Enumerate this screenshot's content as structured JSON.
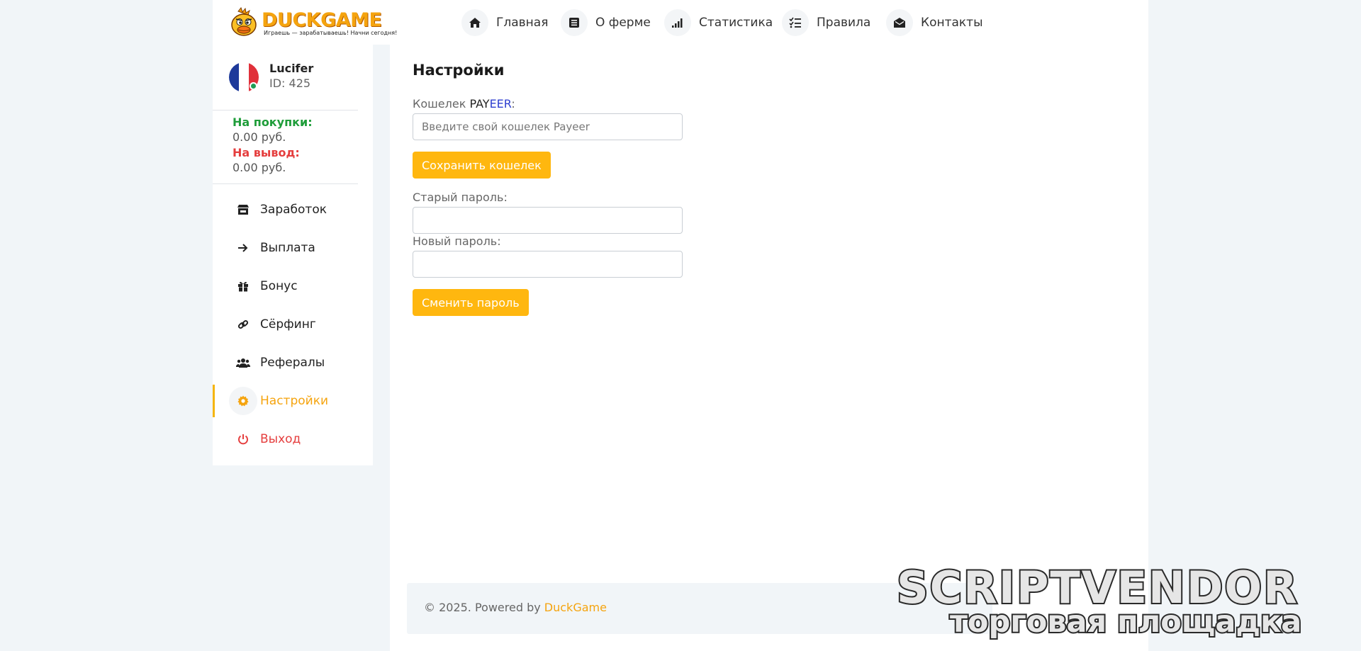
{
  "logo": {
    "title": "DUCKGAME",
    "tagline": "Играешь — зарабатываешь! Начни сегодня!"
  },
  "nav": [
    {
      "label": "Главная",
      "icon": "home-icon"
    },
    {
      "label": "О ферме",
      "icon": "list-icon"
    },
    {
      "label": "Статистика",
      "icon": "signal-icon"
    },
    {
      "label": "Правила",
      "icon": "checklist-icon"
    },
    {
      "label": "Контакты",
      "icon": "envelope-open-icon"
    }
  ],
  "user": {
    "name": "Lucifer",
    "id": "ID: 425"
  },
  "balance": {
    "purchase_label": "На покупки:",
    "purchase_value": "0.00 руб.",
    "withdraw_label": "На вывод:",
    "withdraw_value": "0.00 руб."
  },
  "menu": [
    {
      "label": "Заработок",
      "icon": "store-icon"
    },
    {
      "label": "Выплата",
      "icon": "arrow-right-icon"
    },
    {
      "label": "Бонус",
      "icon": "gift-icon"
    },
    {
      "label": "Сёрфинг",
      "icon": "link-icon"
    },
    {
      "label": "Рефералы",
      "icon": "users-icon"
    },
    {
      "label": "Настройки",
      "icon": "gear-icon"
    },
    {
      "label": "Выход",
      "icon": "power-icon"
    }
  ],
  "settings": {
    "title": "Настройки",
    "wallet_label_prefix": "Кошелек ",
    "wallet_label_pay": "PAY",
    "wallet_label_eer": "EER",
    "wallet_label_suffix": ":",
    "wallet_placeholder": "Введите свой кошелек Payeer",
    "save_wallet_button": "Сохранить кошелек",
    "old_password_label": "Старый пароль:",
    "new_password_label": "Новый пароль:",
    "change_password_button": "Сменить пароль"
  },
  "footer": {
    "text": "© 2025. Powered by ",
    "brand": "DuckGame"
  },
  "watermark": {
    "line1": "SCRIPTVENDOR",
    "line2": "торговая площадка"
  },
  "colors": {
    "accent": "#ffb70f",
    "purchase": "#1f9d3a",
    "withdraw": "#e53e3e",
    "payeer_blue": "#2d3ecf"
  }
}
